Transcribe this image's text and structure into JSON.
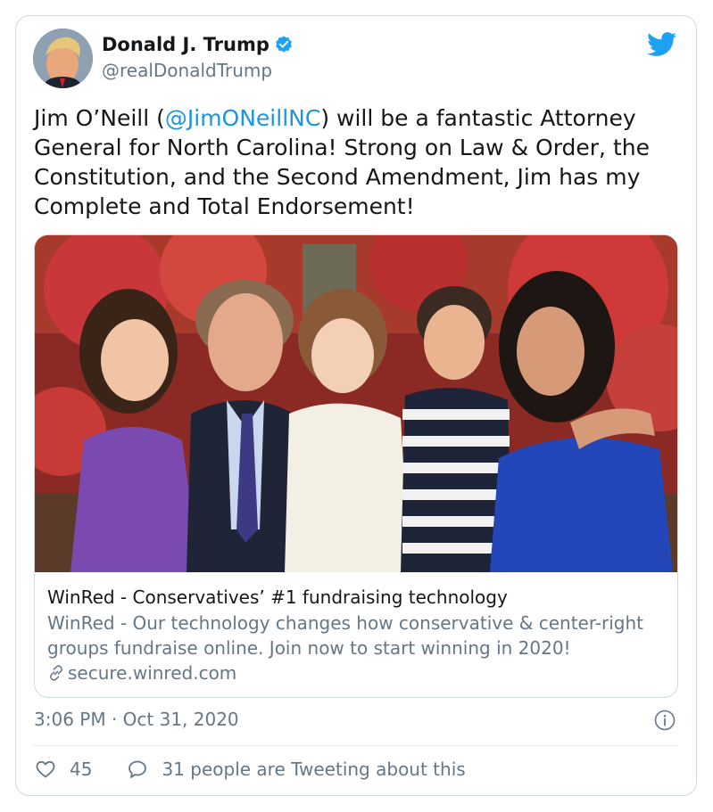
{
  "author": {
    "name": "Donald J. Trump",
    "handle": "@realDonaldTrump",
    "verified_icon": "verified-badge-icon",
    "avatar": "author-avatar"
  },
  "tweet": {
    "text_before": "Jim O’Neill (",
    "mention": "@JimONeillNC",
    "text_after": ") will be a fantastic Attorney General for North Carolina! Strong on Law & Order, the Constitution, and the Second Amendment, Jim has my Complete and Total Endorsement!"
  },
  "card": {
    "image": "family-photo",
    "title": "WinRed - Conservatives’ #1 fundraising technology",
    "description": "WinRed - Our technology changes how conservative & center-right groups fundraise online. Join now to start winning in 2020!",
    "domain": "secure.winred.com",
    "domain_icon": "link-icon"
  },
  "meta": {
    "timestamp": "3:06 PM · Oct 31, 2020",
    "info_icon": "info-icon"
  },
  "engagement": {
    "likes": "45",
    "tweeting_text": "31 people are Tweeting about this",
    "like_icon": "heart-icon",
    "reply_icon": "speech-bubble-icon"
  },
  "colors": {
    "link_blue": "#1b95e0",
    "text": "#14171a",
    "secondary": "#657786",
    "border": "#cfd9de",
    "twitter_blue": "#1da1f2"
  }
}
